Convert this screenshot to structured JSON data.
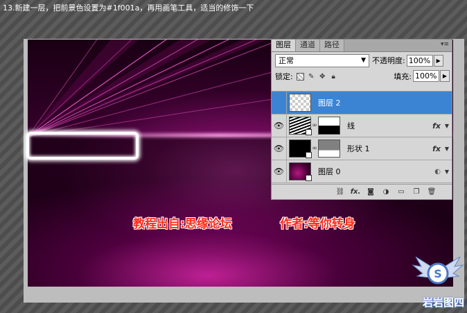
{
  "caption": "13.新建一层，把前景色设置为#1f001a，再用画笔工具，适当的修饰一下",
  "credits": {
    "source": "教程出自:思缘论坛",
    "author": "作者:等你转身"
  },
  "layers_panel": {
    "tabs": [
      "图层",
      "通道",
      "路径"
    ],
    "active_tab": "图层",
    "blend_mode": "正常",
    "opacity_label": "不透明度:",
    "opacity_value": "100%",
    "lock_label": "锁定:",
    "fill_label": "填充:",
    "fill_value": "100%",
    "layers": [
      {
        "name": "图层 2",
        "thumbnail": "transparent",
        "selected": true,
        "has_fx": false
      },
      {
        "name": "线",
        "thumbnail": "lines",
        "selected": false,
        "has_fx": true,
        "mask": "line-mask"
      },
      {
        "name": "形状 1",
        "thumbnail": "black",
        "selected": false,
        "has_fx": true,
        "mask": "shape-mask"
      },
      {
        "name": "图层 0",
        "thumbnail": "pink",
        "selected": false,
        "has_fx": false
      }
    ],
    "fx_label": "fx",
    "toolbar_icons": [
      "link-layers-icon",
      "fx-icon",
      "add-mask-icon",
      "adjustment-layer-icon",
      "new-group-icon",
      "new-layer-icon",
      "trash-icon"
    ]
  },
  "watermark": {
    "logo_text": "岩岩图四"
  },
  "colors": {
    "selection": "#3b84d4",
    "credit_text": "#ff2a1a",
    "canvas_accent": "#b2197f"
  }
}
